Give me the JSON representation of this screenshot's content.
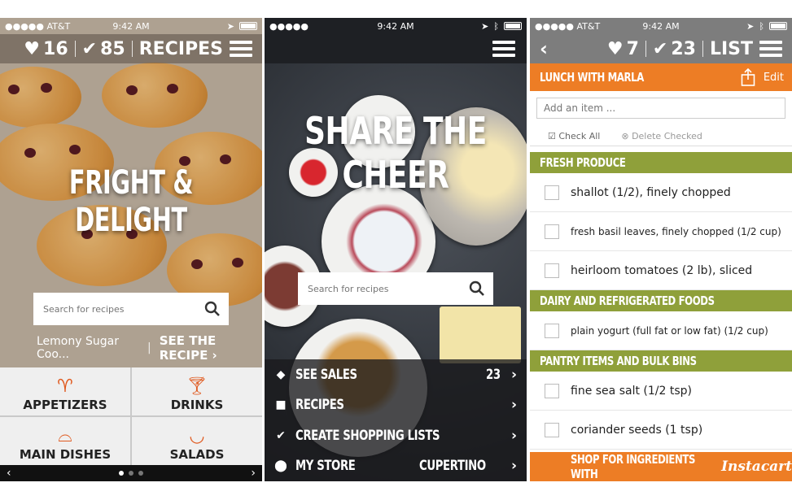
{
  "screen1": {
    "status": {
      "carrier": "●●●●● AT&T",
      "time": "9:42 AM"
    },
    "header": {
      "likes": "16",
      "checks": "85",
      "section": "RECIPES"
    },
    "hero_title": "FRIGHT & DELIGHT",
    "search_placeholder": "Search for recipes",
    "featured_recipe": "Lemony Sugar Coo...",
    "see_recipe": "SEE THE RECIPE",
    "categories": [
      "APPETIZERS",
      "DRINKS",
      "MAIN DISHES",
      "SALADS"
    ]
  },
  "screen2": {
    "status": {
      "carrier": "●●●●●",
      "time": "9:42 AM"
    },
    "hero_title": "SHARE THE CHEER",
    "search_placeholder": "Search for recipes",
    "menu": [
      {
        "label": "SEE SALES",
        "value": "23",
        "icon": "tag-icon"
      },
      {
        "label": "RECIPES",
        "value": "",
        "icon": "chef-hat-icon"
      },
      {
        "label": "CREATE SHOPPING LISTS",
        "value": "",
        "icon": "check-icon"
      },
      {
        "label": "MY STORE",
        "value": "CUPERTINO",
        "icon": "location-pin-icon"
      }
    ]
  },
  "screen3": {
    "status": {
      "carrier": "●●●●● AT&T",
      "time": "9:42 AM"
    },
    "header": {
      "likes": "7",
      "checks": "23",
      "section": "LIST"
    },
    "list_title": "LUNCH WITH MARLA",
    "edit_label": "Edit",
    "add_placeholder": "Add an item ...",
    "check_all": "Check All",
    "delete_checked": "Delete Checked",
    "sections": [
      {
        "title": "FRESH PRODUCE",
        "items": [
          "shallot (1/2), finely chopped",
          "fresh basil leaves, finely chopped (1/2 cup)",
          "heirloom tomatoes (2 lb), sliced"
        ]
      },
      {
        "title": "DAIRY AND REFRIGERATED FOODS",
        "items": [
          "plain yogurt (full fat or low fat) (1/2 cup)"
        ]
      },
      {
        "title": "PANTRY ITEMS AND BULK BINS",
        "items": [
          "fine sea salt (1/2 tsp)",
          "coriander seeds (1 tsp)"
        ]
      }
    ],
    "shop_label": "SHOP FOR INGREDIENTS WITH",
    "shop_brand": "Instacart"
  },
  "colors": {
    "orange": "#ed7d25",
    "olive": "#8fa03a",
    "gray_bar": "#7d7d7d",
    "dark": "#1e2024"
  }
}
